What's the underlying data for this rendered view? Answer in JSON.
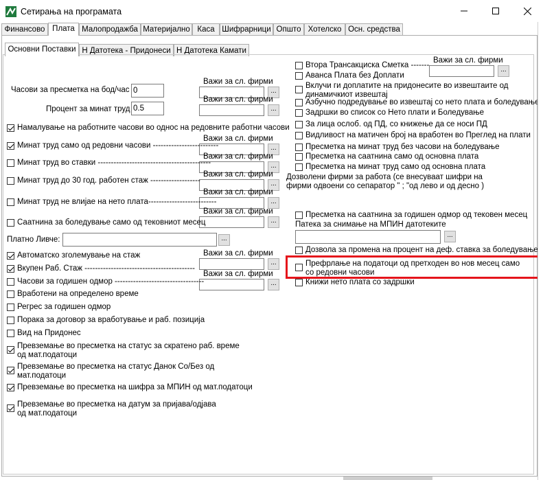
{
  "window": {
    "title": "Сетирања на програмата",
    "minimize_icon": "minimize-icon",
    "maximize_icon": "maximize-icon",
    "close_icon": "close-icon"
  },
  "main_tabs": [
    "Финансово",
    "Плата",
    "Малопродажба",
    "Материјално",
    "Каса",
    "Шифрарници",
    "Општо",
    "Хотелско",
    "Осн. средства"
  ],
  "active_main_tab": "Плата",
  "sub_tabs": [
    "Основни Поставки",
    "Н Датотека - Придонеси",
    "Н Датотека Камати"
  ],
  "active_sub_tab": "Основни Поставки",
  "left": {
    "hours_label": "Часови за пресметка на бод/час",
    "hours_value": "0",
    "percent_label": "Процент за минат труд",
    "percent_value": "0.5",
    "firms_label": "Важи за сл. фирми",
    "dots": "...",
    "checks1": [
      {
        "label": "Намалување на работните часови во однос на редовните работни часови",
        "checked": true
      },
      {
        "label": "Минат труд само од редовни часови -------------------------",
        "checked": true
      },
      {
        "label": "Минат труд во ставки -------------------------------------------",
        "checked": false
      },
      {
        "label": "Минат труд до 30 год. работен стаж -------------------",
        "checked": false
      },
      {
        "label": "Минат труд не влијае на нето плата--------------------------",
        "checked": false
      },
      {
        "label": "Саатнина за боледување само од тековниот месец",
        "checked": false
      }
    ],
    "payslip_label": "Платно Ливче:",
    "checks2": [
      {
        "label": "Автоматско зголемување на стаж",
        "checked": true
      },
      {
        "label": "Вкупен Раб. Стаж ------------------------------------------",
        "checked": true
      },
      {
        "label": "Часови за годишен одмор ----------------------------------",
        "checked": false
      },
      {
        "label": "Вработени на определено време",
        "checked": false
      },
      {
        "label": "Регрес за годишен одмор",
        "checked": false
      },
      {
        "label": "Порака за договор за вработување и раб. позиција",
        "checked": false
      },
      {
        "label": "Вид на Придонес",
        "checked": false
      },
      {
        "label": "Превземање во пресметка на статус за скратено раб. време од мат.податоци",
        "checked": true
      },
      {
        "label": "Превземање во пресметка на статус Данок Со/Без од мат.податоци",
        "checked": true
      },
      {
        "label": "Превземање во пресметка на шифра за МПИН од мат.податоци",
        "checked": true
      },
      {
        "label": "Превземање во пресметка на датум за пријава/одјава од мат.податоци",
        "checked": true
      }
    ]
  },
  "right": {
    "checks1": [
      {
        "label": "Втора Трансакциска Сметка -------",
        "checked": false
      },
      {
        "label": "Аванса Плата без Доплати",
        "checked": false
      },
      {
        "label": "Вклучи ги доплатите на придонесите во извештаите од динамичкиот извештај",
        "checked": false
      },
      {
        "label": "Азбучно подредување во извештај со нето плата и боледување",
        "checked": false
      },
      {
        "label": "Задршки во список со Нето плати и Боледување",
        "checked": false
      },
      {
        "label": "За лица ослоб. од ПД, со книжење да се носи ПД",
        "checked": false
      },
      {
        "label": "Видливост на матичен број на вработен во Преглед на плати",
        "checked": false
      },
      {
        "label": "Пресметка на минат труд без часови на боледување",
        "checked": false
      },
      {
        "label": "Пресметка на саатнина само од основна плата",
        "checked": false
      },
      {
        "label": "Пресметка на минат труд само од основна плата",
        "checked": false
      }
    ],
    "allow_firms_text": "Дозволени фирми за работа (се внесуваат шифри на фирми одвоени со сепаратор \" ; \"од лево и од десно )",
    "annual_leave_label": "Пресметка на саатнина за годишен одмор од тековен месец",
    "mpin_path_label": "Патека за снимање на МПИН датотеките",
    "allow_change_label": "Дозвола за промена на процент на деф. ставка за боледување",
    "transfer_label": "Префрлање на податоци од претходен во нов месец само со редовни часови",
    "book_net_label": "Книжи нето плата со задршки"
  }
}
